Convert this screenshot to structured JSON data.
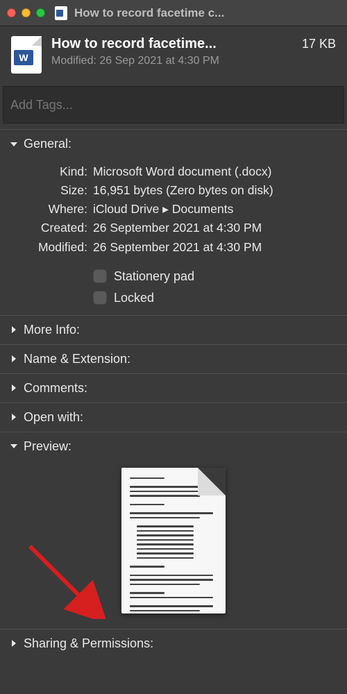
{
  "titlebar": {
    "title": "How to record facetime c..."
  },
  "header": {
    "file_title": "How to record facetime...",
    "file_size": "17 KB",
    "modified": "Modified: 26 Sep 2021 at 4:30 PM"
  },
  "tags": {
    "placeholder": "Add Tags..."
  },
  "sections": {
    "general": {
      "label": "General:",
      "kind_key": "Kind:",
      "kind_val": "Microsoft Word document (.docx)",
      "size_key": "Size:",
      "size_val": "16,951 bytes (Zero bytes on disk)",
      "where_key": "Where:",
      "where_val": "iCloud Drive ▸ Documents",
      "created_key": "Created:",
      "created_val": "26 September 2021 at 4:30 PM",
      "modified_key": "Modified:",
      "modified_val": "26 September 2021 at 4:30 PM",
      "stationery_label": "Stationery pad",
      "locked_label": "Locked"
    },
    "more_info": {
      "label": "More Info:"
    },
    "name_ext": {
      "label": "Name & Extension:"
    },
    "comments": {
      "label": "Comments:"
    },
    "open_with": {
      "label": "Open with:"
    },
    "preview": {
      "label": "Preview:"
    },
    "sharing": {
      "label": "Sharing & Permissions:"
    }
  }
}
